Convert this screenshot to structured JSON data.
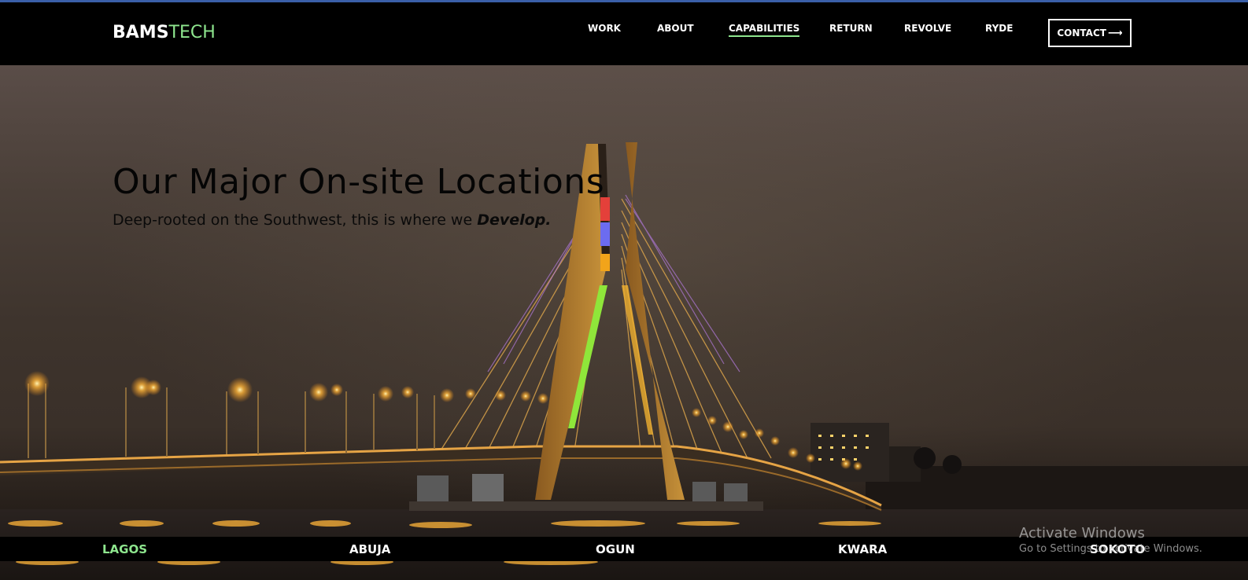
{
  "brand": {
    "name_primary": "BAMS",
    "name_accent": "TECH",
    "accent_color": "#8ee68e"
  },
  "nav": {
    "items": [
      {
        "label": "WORK",
        "active": false
      },
      {
        "label": "ABOUT",
        "active": false
      },
      {
        "label": "CAPABILITIES",
        "active": true
      },
      {
        "label": "RETURN",
        "active": false
      },
      {
        "label": "REVOLVE",
        "active": false
      },
      {
        "label": "RYDE",
        "active": false
      }
    ],
    "contact_label": "CONTACT",
    "contact_icon": "arrow-right-icon"
  },
  "hero": {
    "title": "Our Major On-site Locations",
    "subtitle_prefix": "Deep-rooted on the Southwest, this is where we ",
    "subtitle_emphasis": "Develop.",
    "background": "night-bridge-photo"
  },
  "locations": [
    {
      "label": "LAGOS",
      "active": true
    },
    {
      "label": "ABUJA",
      "active": false
    },
    {
      "label": "OGUN",
      "active": false
    },
    {
      "label": "KWARA",
      "active": false
    },
    {
      "label": "SOKOTO",
      "active": false
    }
  ],
  "watermark": {
    "line1": "Activate Windows",
    "line2": "Go to Settings to activate Windows."
  }
}
